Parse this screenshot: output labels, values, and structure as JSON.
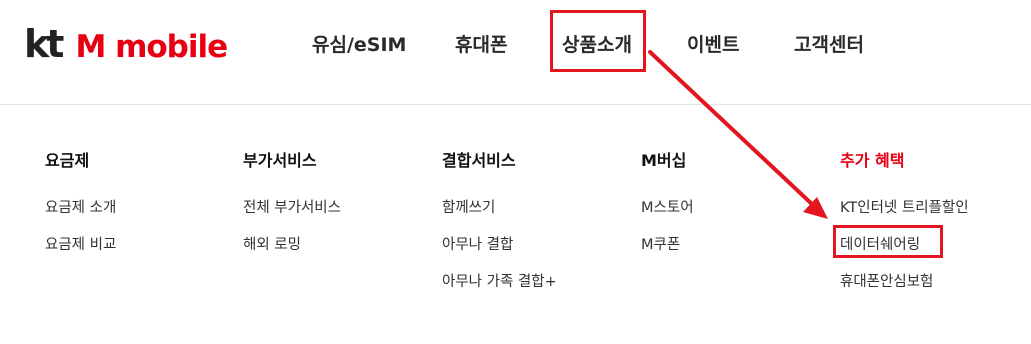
{
  "logo": {
    "kt": "kt",
    "brand": "M mobile"
  },
  "nav": [
    {
      "label": "유심/eSIM"
    },
    {
      "label": "휴대폰"
    },
    {
      "label": "상품소개"
    },
    {
      "label": "이벤트"
    },
    {
      "label": "고객센터"
    }
  ],
  "menu": {
    "columns": [
      {
        "title": "요금제",
        "links": [
          "요금제 소개",
          "요금제 비교"
        ]
      },
      {
        "title": "부가서비스",
        "links": [
          "전체 부가서비스",
          "해외 로밍"
        ]
      },
      {
        "title": "결합서비스",
        "links": [
          "함께쓰기",
          "아무나 결합",
          "아무나 가족 결합+"
        ]
      },
      {
        "title": "M버십",
        "links": [
          "M스토어",
          "M쿠폰"
        ]
      },
      {
        "title": "추가 혜택",
        "links": [
          "KT인터넷 트리플할인",
          "데이터쉐어링",
          "휴대폰안심보험"
        ]
      }
    ]
  },
  "colors": {
    "brand_red": "#e60012",
    "highlight_red": "#e3161f"
  }
}
